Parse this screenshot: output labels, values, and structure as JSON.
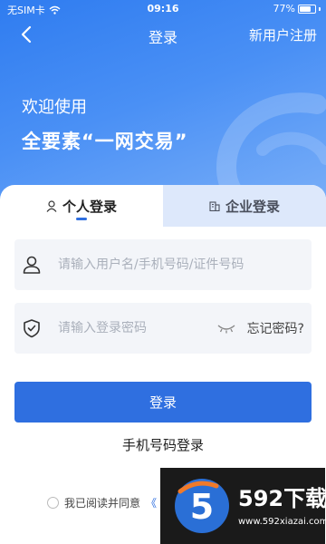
{
  "status_bar": {
    "carrier": "无SIM卡",
    "time": "09:16",
    "battery_percent": "77%",
    "battery_level": 0.77
  },
  "nav": {
    "back_icon": "chevron-left-icon",
    "title": "登录",
    "register_label": "新用户注册"
  },
  "hero": {
    "welcome": "欢迎使用",
    "slogan": "全要素“一网交易”"
  },
  "tabs": [
    {
      "label": "个人登录",
      "icon": "person-icon",
      "active": true
    },
    {
      "label": "企业登录",
      "icon": "building-icon",
      "active": false
    }
  ],
  "form": {
    "username_placeholder": "请输入用户名/手机号码/证件号码",
    "username_value": "",
    "password_placeholder": "请输入登录密码",
    "password_value": "",
    "forgot_label": "忘记密码?",
    "login_label": "登录",
    "phone_login_label": "手机号码登录"
  },
  "agreement": {
    "text": "我已阅读并同意",
    "link": "《",
    "checked": false
  },
  "watermark": {
    "title": "592下载",
    "url": "www.592xiazai.com"
  },
  "colors": {
    "primary": "#2f6fe0",
    "hero_gradient_start": "#2f7cf0",
    "hero_gradient_end": "#7fb2f8",
    "tab_inactive_bg": "#dde8fb",
    "field_bg": "#f3f5f9"
  }
}
